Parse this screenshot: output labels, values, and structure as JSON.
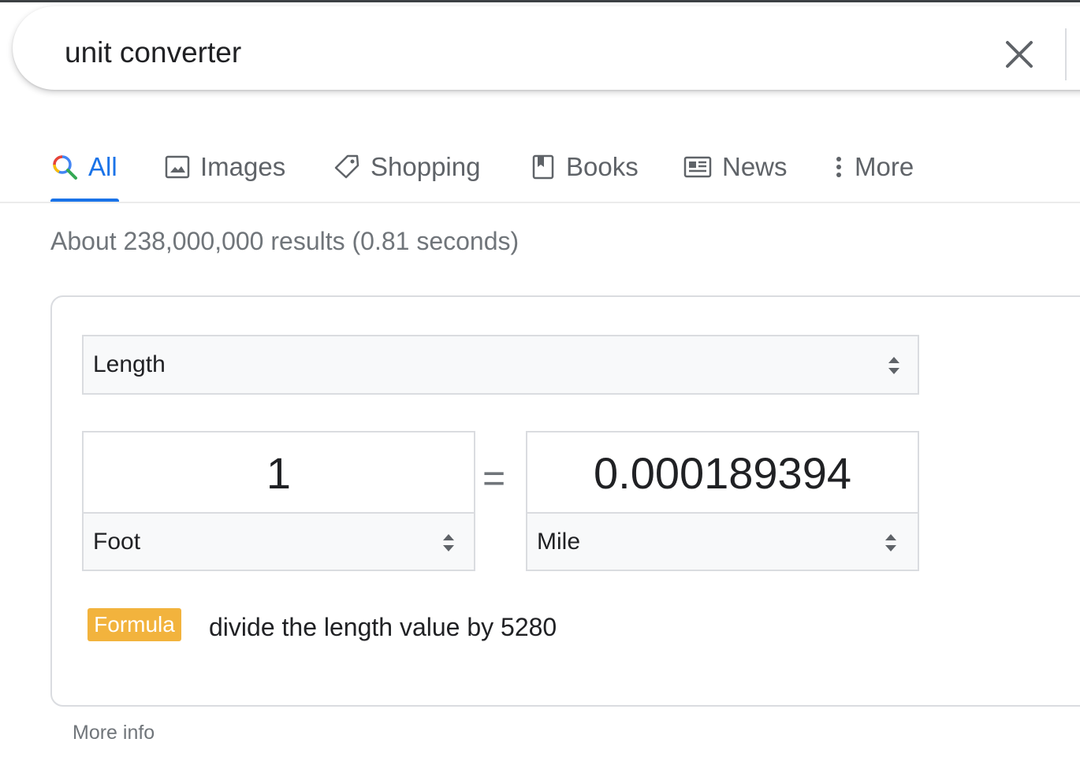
{
  "search": {
    "query": "unit converter"
  },
  "tabs": [
    {
      "label": "All",
      "icon": "search-icon",
      "active": true
    },
    {
      "label": "Images",
      "icon": "image-icon",
      "active": false
    },
    {
      "label": "Shopping",
      "icon": "tag-icon",
      "active": false
    },
    {
      "label": "Books",
      "icon": "book-icon",
      "active": false
    },
    {
      "label": "News",
      "icon": "news-icon",
      "active": false
    },
    {
      "label": "More",
      "icon": "more-vert-icon",
      "active": false
    }
  ],
  "result_stats": "About 238,000,000 results (0.81 seconds)",
  "converter": {
    "category": "Length",
    "from_value": "1",
    "from_unit": "Foot",
    "equals": "=",
    "to_value": "0.000189394",
    "to_unit": "Mile",
    "formula_badge": "Formula",
    "formula_text": "divide the length value by 5280"
  },
  "more_info": "More info",
  "colors": {
    "accent": "#1a73e8",
    "formula_badge": "#f2b33d",
    "muted_text": "#70757a"
  }
}
